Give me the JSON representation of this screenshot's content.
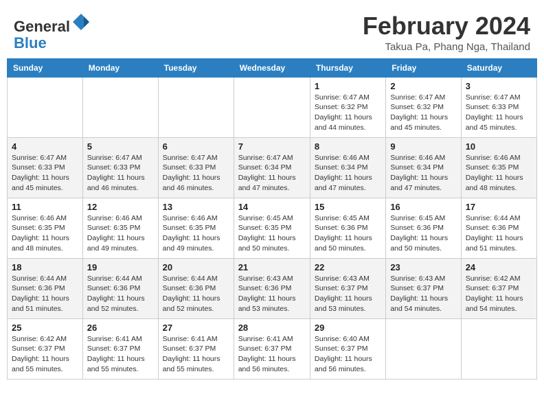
{
  "header": {
    "logo_line1": "General",
    "logo_line2": "Blue",
    "title": "February 2024",
    "subtitle": "Takua Pa, Phang Nga, Thailand"
  },
  "weekdays": [
    "Sunday",
    "Monday",
    "Tuesday",
    "Wednesday",
    "Thursday",
    "Friday",
    "Saturday"
  ],
  "weeks": [
    [
      {
        "day": "",
        "info": ""
      },
      {
        "day": "",
        "info": ""
      },
      {
        "day": "",
        "info": ""
      },
      {
        "day": "",
        "info": ""
      },
      {
        "day": "1",
        "info": "Sunrise: 6:47 AM\nSunset: 6:32 PM\nDaylight: 11 hours and 44 minutes."
      },
      {
        "day": "2",
        "info": "Sunrise: 6:47 AM\nSunset: 6:32 PM\nDaylight: 11 hours and 45 minutes."
      },
      {
        "day": "3",
        "info": "Sunrise: 6:47 AM\nSunset: 6:33 PM\nDaylight: 11 hours and 45 minutes."
      }
    ],
    [
      {
        "day": "4",
        "info": "Sunrise: 6:47 AM\nSunset: 6:33 PM\nDaylight: 11 hours and 45 minutes."
      },
      {
        "day": "5",
        "info": "Sunrise: 6:47 AM\nSunset: 6:33 PM\nDaylight: 11 hours and 46 minutes."
      },
      {
        "day": "6",
        "info": "Sunrise: 6:47 AM\nSunset: 6:33 PM\nDaylight: 11 hours and 46 minutes."
      },
      {
        "day": "7",
        "info": "Sunrise: 6:47 AM\nSunset: 6:34 PM\nDaylight: 11 hours and 47 minutes."
      },
      {
        "day": "8",
        "info": "Sunrise: 6:46 AM\nSunset: 6:34 PM\nDaylight: 11 hours and 47 minutes."
      },
      {
        "day": "9",
        "info": "Sunrise: 6:46 AM\nSunset: 6:34 PM\nDaylight: 11 hours and 47 minutes."
      },
      {
        "day": "10",
        "info": "Sunrise: 6:46 AM\nSunset: 6:35 PM\nDaylight: 11 hours and 48 minutes."
      }
    ],
    [
      {
        "day": "11",
        "info": "Sunrise: 6:46 AM\nSunset: 6:35 PM\nDaylight: 11 hours and 48 minutes."
      },
      {
        "day": "12",
        "info": "Sunrise: 6:46 AM\nSunset: 6:35 PM\nDaylight: 11 hours and 49 minutes."
      },
      {
        "day": "13",
        "info": "Sunrise: 6:46 AM\nSunset: 6:35 PM\nDaylight: 11 hours and 49 minutes."
      },
      {
        "day": "14",
        "info": "Sunrise: 6:45 AM\nSunset: 6:35 PM\nDaylight: 11 hours and 50 minutes."
      },
      {
        "day": "15",
        "info": "Sunrise: 6:45 AM\nSunset: 6:36 PM\nDaylight: 11 hours and 50 minutes."
      },
      {
        "day": "16",
        "info": "Sunrise: 6:45 AM\nSunset: 6:36 PM\nDaylight: 11 hours and 50 minutes."
      },
      {
        "day": "17",
        "info": "Sunrise: 6:44 AM\nSunset: 6:36 PM\nDaylight: 11 hours and 51 minutes."
      }
    ],
    [
      {
        "day": "18",
        "info": "Sunrise: 6:44 AM\nSunset: 6:36 PM\nDaylight: 11 hours and 51 minutes."
      },
      {
        "day": "19",
        "info": "Sunrise: 6:44 AM\nSunset: 6:36 PM\nDaylight: 11 hours and 52 minutes."
      },
      {
        "day": "20",
        "info": "Sunrise: 6:44 AM\nSunset: 6:36 PM\nDaylight: 11 hours and 52 minutes."
      },
      {
        "day": "21",
        "info": "Sunrise: 6:43 AM\nSunset: 6:36 PM\nDaylight: 11 hours and 53 minutes."
      },
      {
        "day": "22",
        "info": "Sunrise: 6:43 AM\nSunset: 6:37 PM\nDaylight: 11 hours and 53 minutes."
      },
      {
        "day": "23",
        "info": "Sunrise: 6:43 AM\nSunset: 6:37 PM\nDaylight: 11 hours and 54 minutes."
      },
      {
        "day": "24",
        "info": "Sunrise: 6:42 AM\nSunset: 6:37 PM\nDaylight: 11 hours and 54 minutes."
      }
    ],
    [
      {
        "day": "25",
        "info": "Sunrise: 6:42 AM\nSunset: 6:37 PM\nDaylight: 11 hours and 55 minutes."
      },
      {
        "day": "26",
        "info": "Sunrise: 6:41 AM\nSunset: 6:37 PM\nDaylight: 11 hours and 55 minutes."
      },
      {
        "day": "27",
        "info": "Sunrise: 6:41 AM\nSunset: 6:37 PM\nDaylight: 11 hours and 55 minutes."
      },
      {
        "day": "28",
        "info": "Sunrise: 6:41 AM\nSunset: 6:37 PM\nDaylight: 11 hours and 56 minutes."
      },
      {
        "day": "29",
        "info": "Sunrise: 6:40 AM\nSunset: 6:37 PM\nDaylight: 11 hours and 56 minutes."
      },
      {
        "day": "",
        "info": ""
      },
      {
        "day": "",
        "info": ""
      }
    ]
  ]
}
